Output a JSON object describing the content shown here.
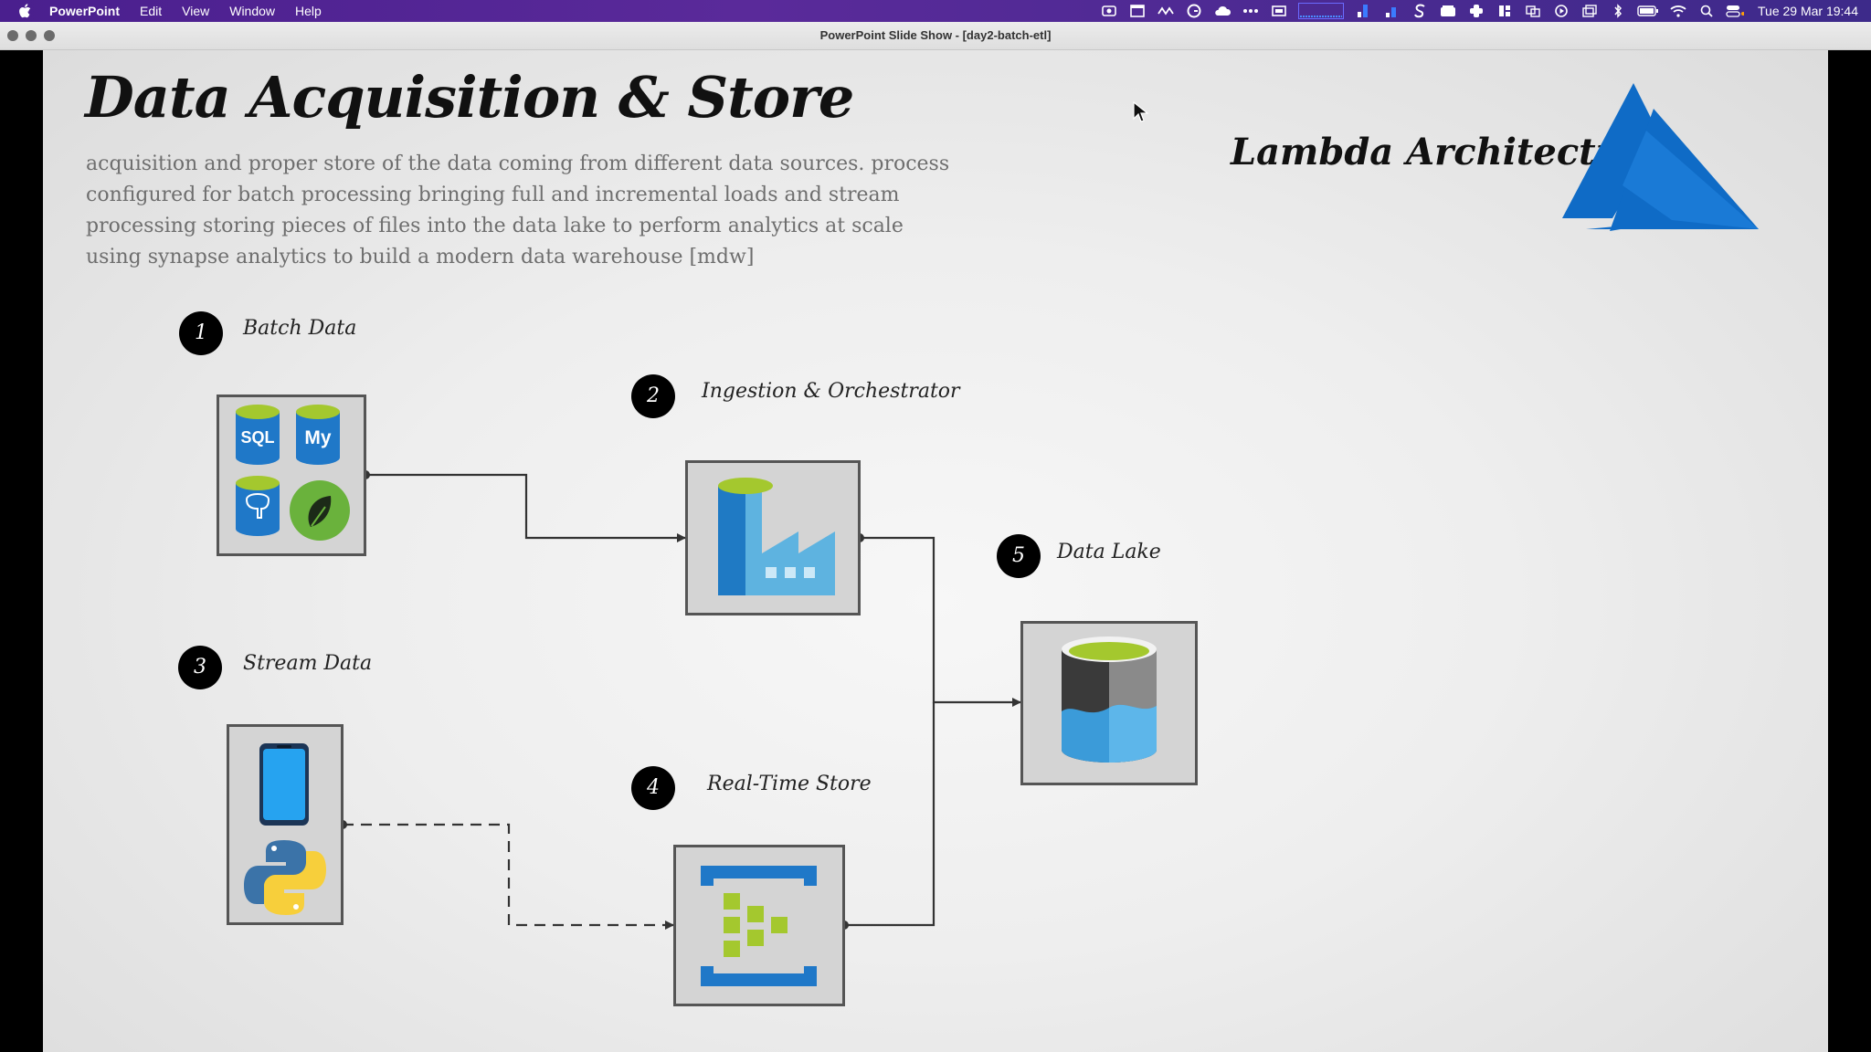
{
  "menubar": {
    "app_name": "PowerPoint",
    "menus": [
      "Edit",
      "View",
      "Window",
      "Help"
    ],
    "clock": "Tue 29 Mar 19:44"
  },
  "window": {
    "title": "PowerPoint Slide Show - [day2-batch-etl]"
  },
  "slide": {
    "title": "Data Acquisition & Store",
    "description": "acquisition and proper store of the data coming from different data sources. process configured for batch processing bringing full and incremental loads and stream processing storing pieces of files into the data lake to perform analytics at scale using synapse analytics to build a modern data warehouse [mdw]",
    "lambda_label": "Lambda Architecture",
    "steps": [
      {
        "number": "1",
        "label": "Batch Data"
      },
      {
        "number": "2",
        "label": "Ingestion & Orchestrator"
      },
      {
        "number": "3",
        "label": "Stream Data"
      },
      {
        "number": "4",
        "label": "Real-Time Store"
      },
      {
        "number": "5",
        "label": "Data Lake"
      }
    ],
    "batch_icons": [
      "sql-database-icon",
      "mysql-icon",
      "postgresql-icon",
      "mongodb-icon"
    ],
    "stream_icons": [
      "mobile-phone-icon",
      "python-icon"
    ],
    "colors": {
      "azure_blue": "#0f6bc6",
      "lime": "#a4c82e",
      "box_fill": "#d4d4d4"
    }
  }
}
